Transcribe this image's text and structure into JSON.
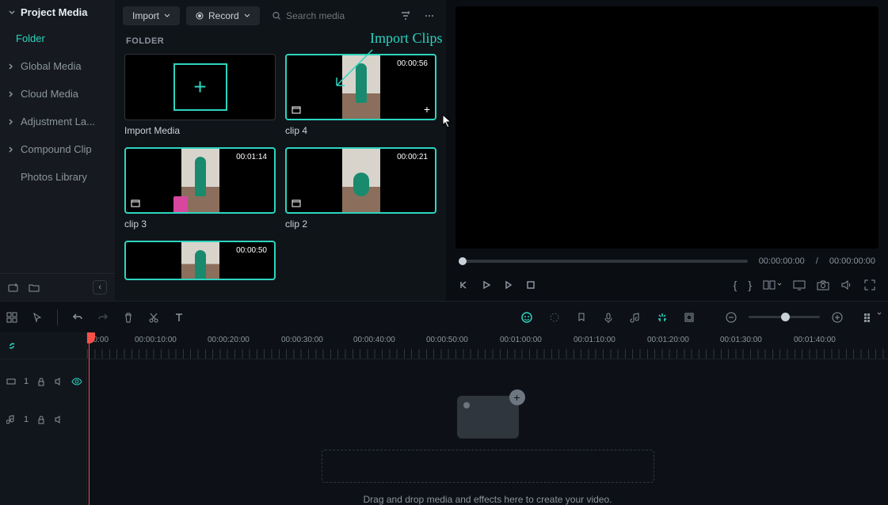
{
  "sidebar": {
    "title": "Project Media",
    "folder_label": "Folder",
    "items": [
      "Global Media",
      "Cloud Media",
      "Adjustment La...",
      "Compound Clip",
      "Photos Library"
    ]
  },
  "toolbar": {
    "import_label": "Import",
    "record_label": "Record"
  },
  "search": {
    "placeholder": "Search media"
  },
  "folder_section_label": "FOLDER",
  "annotation_text": "Import Clips",
  "clips": {
    "import_label": "Import Media",
    "c1": {
      "name": "clip 4",
      "duration": "00:00:56"
    },
    "c2": {
      "name": "clip 3",
      "duration": "00:01:14"
    },
    "c3": {
      "name": "clip 2",
      "duration": "00:00:21"
    },
    "c4": {
      "name": "",
      "duration": "00:00:50"
    }
  },
  "preview": {
    "time_current": "00:00:00:00",
    "time_sep": "/",
    "time_total": "00:00:00:00"
  },
  "timeline": {
    "labels": [
      "00:00",
      "00:00:10:00",
      "00:00:20:00",
      "00:00:30:00",
      "00:00:40:00",
      "00:00:50:00",
      "00:01:00:00",
      "00:01:10:00",
      "00:01:20:00",
      "00:01:30:00",
      "00:01:40:00"
    ],
    "video_track": "1",
    "audio_track": "1",
    "drop_text": "Drag and drop media and effects here to create your video."
  }
}
